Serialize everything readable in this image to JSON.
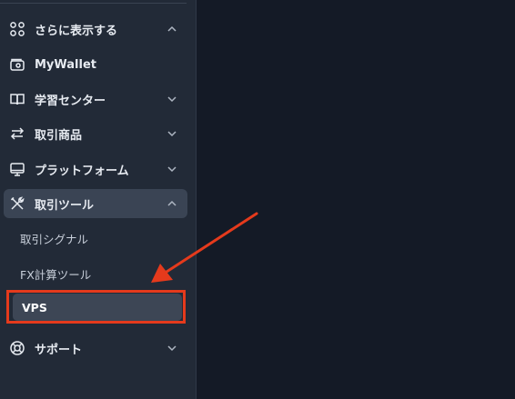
{
  "sidebar": {
    "items": [
      {
        "label": "さらに表示する",
        "icon": "grid-icon",
        "expanded": true
      },
      {
        "label": "MyWallet",
        "icon": "wallet-icon"
      },
      {
        "label": "学習センター",
        "icon": "book-icon",
        "expanded": false
      },
      {
        "label": "取引商品",
        "icon": "swap-arrows-icon",
        "expanded": false
      },
      {
        "label": "プラットフォーム",
        "icon": "monitor-icon",
        "expanded": false
      },
      {
        "label": "取引ツール",
        "icon": "tools-icon",
        "expanded": true
      },
      {
        "label": "サポート",
        "icon": "lifebuoy-icon",
        "expanded": false
      }
    ],
    "subitems": [
      {
        "label": "取引シグナル"
      },
      {
        "label": "FX計算ツール"
      },
      {
        "label": "VPS",
        "selected": true
      }
    ]
  },
  "annotation": {
    "highlight_color": "#e53a1c",
    "arrow_color": "#e53a1c"
  }
}
